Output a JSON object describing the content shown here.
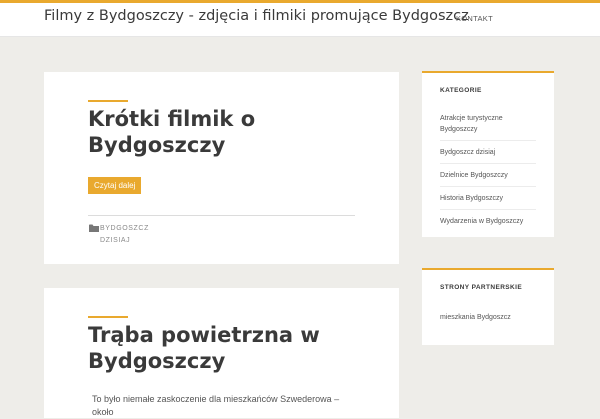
{
  "header": {
    "site_title": "Filmy z Bydgoszczy - zdjęcia i filmiki promujące Bydgoszcz",
    "nav": [
      "KONTAKT"
    ]
  },
  "posts": [
    {
      "title": "Krótki filmik o Bydgoszczy",
      "read_more": "Czytaj dalej",
      "category": "BYDGOSZCZ DZISIAJ",
      "category_icon": "folder-icon"
    },
    {
      "title": "Trąba powietrzna w Bydgoszczy",
      "excerpt": "To było niemałe zaskoczenie dla mieszkańców Szwederowa – około"
    }
  ],
  "sidebar": {
    "categories": {
      "title": "KATEGORIE",
      "items": [
        "Atrakcje turystyczne Bydgoszczy",
        "Bydgoszcz dzisiaj",
        "Dzielnice Bydgoszczy",
        "Historia Bydgoszczy",
        "Wydarzenia w Bydgoszczy"
      ]
    },
    "partners": {
      "title": "STRONY PARTNERSKIE",
      "items": [
        "mieszkania Bydgoszcz"
      ]
    }
  },
  "colors": {
    "accent": "#e9a92e",
    "background": "#eeede9",
    "card": "#ffffff",
    "text": "#3a3a3a"
  }
}
